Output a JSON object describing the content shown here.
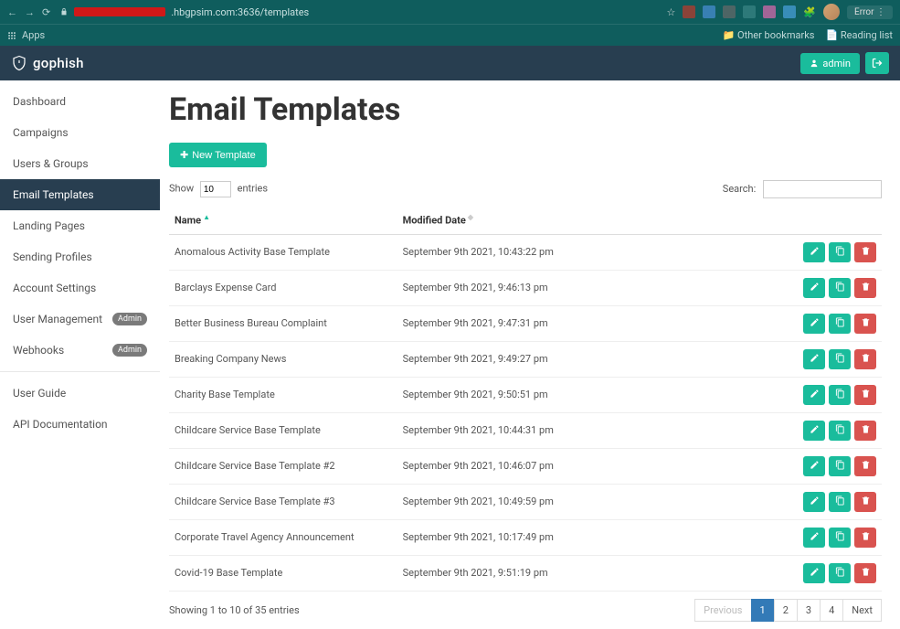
{
  "browser": {
    "url_suffix": ".hbgpsim.com:3636/templates",
    "error_label": "Error",
    "bookmarks_apps": "Apps",
    "other_bookmarks": "Other bookmarks",
    "reading_list": "Reading list"
  },
  "header": {
    "logo": "gophish",
    "admin": "admin"
  },
  "sidebar": {
    "items": [
      {
        "label": "Dashboard"
      },
      {
        "label": "Campaigns"
      },
      {
        "label": "Users & Groups"
      },
      {
        "label": "Email Templates",
        "active": true
      },
      {
        "label": "Landing Pages"
      },
      {
        "label": "Sending Profiles"
      },
      {
        "label": "Account Settings"
      },
      {
        "label": "User Management",
        "badge": "Admin"
      },
      {
        "label": "Webhooks",
        "badge": "Admin"
      }
    ],
    "secondary": [
      {
        "label": "User Guide"
      },
      {
        "label": "API Documentation"
      }
    ]
  },
  "page": {
    "title": "Email Templates",
    "new_button": "New Template",
    "show_prefix": "Show",
    "show_suffix": "entries",
    "show_value": "10",
    "search_label": "Search:",
    "info": "Showing 1 to 10 of 35 entries",
    "columns": {
      "name": "Name",
      "modified": "Modified Date"
    },
    "rows": [
      {
        "name": "Anomalous Activity Base Template",
        "modified": "September 9th 2021, 10:43:22 pm"
      },
      {
        "name": "Barclays Expense Card",
        "modified": "September 9th 2021, 9:46:13 pm"
      },
      {
        "name": "Better Business Bureau Complaint",
        "modified": "September 9th 2021, 9:47:31 pm"
      },
      {
        "name": "Breaking Company News",
        "modified": "September 9th 2021, 9:49:27 pm"
      },
      {
        "name": "Charity Base Template",
        "modified": "September 9th 2021, 9:50:51 pm"
      },
      {
        "name": "Childcare Service Base Template",
        "modified": "September 9th 2021, 10:44:31 pm"
      },
      {
        "name": "Childcare Service Base Template #2",
        "modified": "September 9th 2021, 10:46:07 pm"
      },
      {
        "name": "Childcare Service Base Template #3",
        "modified": "September 9th 2021, 10:49:59 pm"
      },
      {
        "name": "Corporate Travel Agency Announcement",
        "modified": "September 9th 2021, 10:17:49 pm"
      },
      {
        "name": "Covid-19 Base Template",
        "modified": "September 9th 2021, 9:51:19 pm"
      }
    ],
    "pagination": {
      "previous": "Previous",
      "next": "Next",
      "pages": [
        "1",
        "2",
        "3",
        "4"
      ],
      "current": "1"
    }
  }
}
